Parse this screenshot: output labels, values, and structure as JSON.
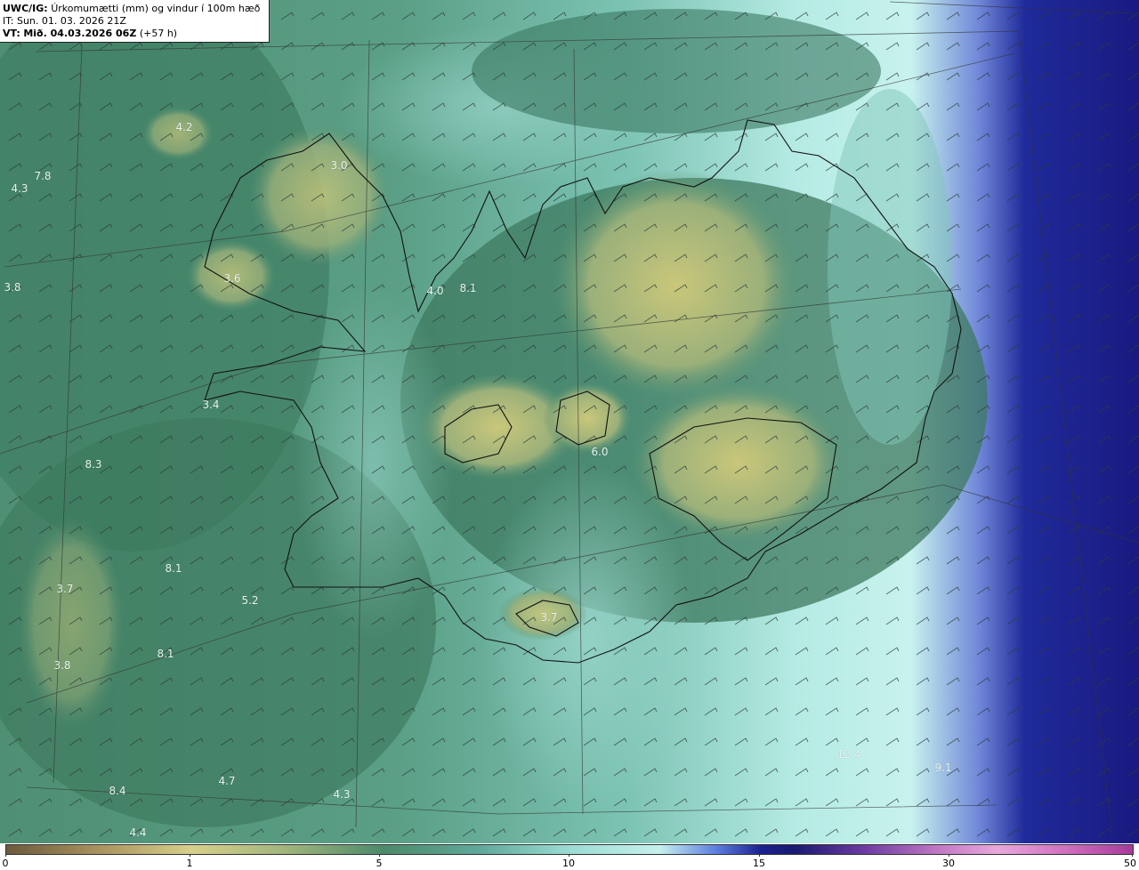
{
  "header": {
    "model": "UWC/IG:",
    "title": "Úrkomumætti (mm) og vindur í 100m hæð",
    "it_line": "IT: Sun. 01. 03. 2026 21Z",
    "vt_prefix": "VT:",
    "vt_value": "Mið. 04.03.2026 06Z",
    "vt_lead": "(+57 h)"
  },
  "colors": {
    "land_dark": "#3e7a5e",
    "land_yellow": "#c9c77a",
    "sea_teal": "#5fa89a",
    "sea_light": "#bfeee8",
    "deep_blue": "#1a1d8a"
  },
  "value_labels": [
    {
      "text": "4.2"
    },
    {
      "text": "3.0"
    },
    {
      "text": "4.3"
    },
    {
      "text": "7.8"
    },
    {
      "text": "3.8"
    },
    {
      "text": "3.6"
    },
    {
      "text": "4.0"
    },
    {
      "text": "8.1"
    },
    {
      "text": "3.4"
    },
    {
      "text": "6.0"
    },
    {
      "text": "8.3"
    },
    {
      "text": "8.1"
    },
    {
      "text": "3.7"
    },
    {
      "text": "5.2"
    },
    {
      "text": "3.7"
    },
    {
      "text": "8.1"
    },
    {
      "text": "3.8"
    },
    {
      "text": "4.7"
    },
    {
      "text": "8.4"
    },
    {
      "text": "4.3"
    },
    {
      "text": "4.4"
    },
    {
      "text": "12.4"
    },
    {
      "text": "9.1"
    }
  ],
  "colorbar": {
    "ticks": [
      "0",
      "1",
      "5",
      "10",
      "15",
      "30",
      "50"
    ]
  }
}
